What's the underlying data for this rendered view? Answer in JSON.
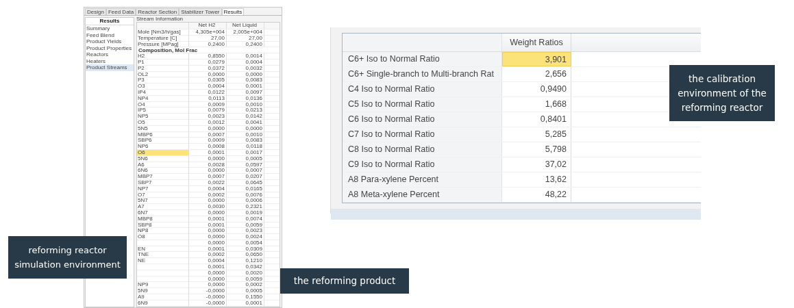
{
  "simulator": {
    "tabs": [
      {
        "label": "Design",
        "selected": false
      },
      {
        "label": "Feed Data",
        "selected": false
      },
      {
        "label": "Reactor Section",
        "selected": false
      },
      {
        "label": "Stabilizer Tower",
        "selected": false
      },
      {
        "label": "Results",
        "selected": true
      }
    ],
    "sidebar": {
      "title": "Results",
      "items": [
        {
          "label": "Summary",
          "selected": false
        },
        {
          "label": "Feed Blend",
          "selected": false
        },
        {
          "label": "Product Yields",
          "selected": false
        },
        {
          "label": "Product Properties",
          "selected": false
        },
        {
          "label": "Reactors",
          "selected": false
        },
        {
          "label": "Heaters",
          "selected": false
        },
        {
          "label": "Product Streams",
          "selected": true
        }
      ]
    },
    "group_title": "Stream Information",
    "columns": [
      "Net H2",
      "Net Liquid"
    ],
    "rows": [
      {
        "kind": "data",
        "label": "Mole [Nm3/h/gas]",
        "values": [
          "4,305e+004",
          "2,005e+004"
        ],
        "selected": false
      },
      {
        "kind": "data",
        "label": "Temperature [C]",
        "values": [
          "27,00",
          "27,00"
        ],
        "selected": false
      },
      {
        "kind": "data",
        "label": "Pressure [MPag]",
        "values": [
          "0,2400",
          "0,2400"
        ],
        "selected": false
      },
      {
        "kind": "section",
        "label": "Composition, Mol Frac"
      },
      {
        "kind": "data",
        "label": "H2",
        "values": [
          "0,8550",
          "0,0014"
        ],
        "selected": false
      },
      {
        "kind": "data",
        "label": "P1",
        "values": [
          "0,0279",
          "0,0004"
        ],
        "selected": false
      },
      {
        "kind": "data",
        "label": "P2",
        "values": [
          "0,0372",
          "0,0032"
        ],
        "selected": false
      },
      {
        "kind": "data",
        "label": "OL2",
        "values": [
          "0,0000",
          "0,0000"
        ],
        "selected": false
      },
      {
        "kind": "data",
        "label": "P3",
        "values": [
          "0,0305",
          "0,0083"
        ],
        "selected": false
      },
      {
        "kind": "data",
        "label": "O3",
        "values": [
          "0,0004",
          "0,0001"
        ],
        "selected": false
      },
      {
        "kind": "data",
        "label": "IP4",
        "values": [
          "0,0122",
          "0,0097"
        ],
        "selected": false
      },
      {
        "kind": "data",
        "label": "NP4",
        "values": [
          "0,0113",
          "0,0136"
        ],
        "selected": false
      },
      {
        "kind": "data",
        "label": "O4",
        "values": [
          "0,0009",
          "0,0010"
        ],
        "selected": false
      },
      {
        "kind": "data",
        "label": "IP5",
        "values": [
          "0,0079",
          "0,0213"
        ],
        "selected": false
      },
      {
        "kind": "data",
        "label": "NP5",
        "values": [
          "0,0023",
          "0,0142"
        ],
        "selected": false
      },
      {
        "kind": "data",
        "label": "O5",
        "values": [
          "0,0012",
          "0,0041"
        ],
        "selected": false
      },
      {
        "kind": "data",
        "label": "5N5",
        "values": [
          "0,0000",
          "0,0000"
        ],
        "selected": false
      },
      {
        "kind": "data",
        "label": "MBP6",
        "values": [
          "0,0007",
          "0,0010"
        ],
        "selected": false
      },
      {
        "kind": "data",
        "label": "SBP6",
        "values": [
          "0,0009",
          "0,0083"
        ],
        "selected": false
      },
      {
        "kind": "data",
        "label": "NP6",
        "values": [
          "0,0008",
          "0,0118"
        ],
        "selected": false
      },
      {
        "kind": "data",
        "label": "O6",
        "values": [
          "0,0001",
          "0,0017"
        ],
        "selected": true
      },
      {
        "kind": "data",
        "label": "5N6",
        "values": [
          "0,0000",
          "0,0005"
        ],
        "selected": false
      },
      {
        "kind": "data",
        "label": "A6",
        "values": [
          "0,0028",
          "0,0597"
        ],
        "selected": false
      },
      {
        "kind": "data",
        "label": "6N6",
        "values": [
          "0,0000",
          "0,0007"
        ],
        "selected": false
      },
      {
        "kind": "data",
        "label": "MBP7",
        "values": [
          "0,0007",
          "0,0207"
        ],
        "selected": false
      },
      {
        "kind": "data",
        "label": "SBP7",
        "values": [
          "0,0022",
          "0,0645"
        ],
        "selected": false
      },
      {
        "kind": "data",
        "label": "NP7",
        "values": [
          "0,0004",
          "0,0165"
        ],
        "selected": false
      },
      {
        "kind": "data",
        "label": "O7",
        "values": [
          "0,0002",
          "0,0076"
        ],
        "selected": false
      },
      {
        "kind": "data",
        "label": "5N7",
        "values": [
          "0,0000",
          "0,0006"
        ],
        "selected": false
      },
      {
        "kind": "data",
        "label": "A7",
        "values": [
          "0,0030",
          "0,2321"
        ],
        "selected": false
      },
      {
        "kind": "data",
        "label": "6N7",
        "values": [
          "0,0000",
          "0,0019"
        ],
        "selected": false
      },
      {
        "kind": "data",
        "label": "MBP8",
        "values": [
          "0,0001",
          "0,0074"
        ],
        "selected": false
      },
      {
        "kind": "data",
        "label": "SBP8",
        "values": [
          "0,0001",
          "0,0059"
        ],
        "selected": false
      },
      {
        "kind": "data",
        "label": "NP8",
        "values": [
          "0,0000",
          "0,0023"
        ],
        "selected": false
      },
      {
        "kind": "data",
        "label": "O8",
        "values": [
          "0,0000",
          "0,0024"
        ],
        "selected": false
      },
      {
        "kind": "data",
        "values": [
          "0,0000",
          "0,0054"
        ],
        "selected": false
      },
      {
        "kind": "data",
        "label": "EN",
        "values": [
          "0,0001",
          "0,0309"
        ],
        "selected": false
      },
      {
        "kind": "data",
        "label": "TNE",
        "values": [
          "0,0002",
          "0,0650"
        ],
        "selected": false
      },
      {
        "kind": "data",
        "label": "NE",
        "values": [
          "0,0004",
          "0,1210"
        ],
        "selected": false
      },
      {
        "kind": "data",
        "values": [
          "0,0001",
          "0,0342"
        ],
        "selected": false
      },
      {
        "kind": "data",
        "values": [
          "0,0000",
          "0,0020"
        ],
        "selected": false
      },
      {
        "kind": "data",
        "values": [
          "0,0000",
          "0,0059"
        ],
        "selected": false
      },
      {
        "kind": "data",
        "label": "NP9",
        "values": [
          "0,0000",
          "0,0002"
        ],
        "selected": false
      },
      {
        "kind": "data",
        "label": "5N9",
        "values": [
          "-0,0000",
          "0,0005"
        ],
        "selected": false
      },
      {
        "kind": "data",
        "label": "A9",
        "values": [
          "-0,0000",
          "0,1550"
        ],
        "selected": false
      },
      {
        "kind": "data",
        "label": "6N9",
        "values": [
          "-0,0000",
          "0,0001"
        ],
        "selected": false
      }
    ]
  },
  "ratios": {
    "columns": [
      "Weight Ratios"
    ],
    "rows": [
      {
        "label": "C6+ Iso to Normal Ratio",
        "value": "3,901",
        "selected": true
      },
      {
        "label": "C6+ Single-branch to Multi-branch Rat",
        "value": "2,656",
        "selected": false
      },
      {
        "label": "C4 Iso to Normal Ratio",
        "value": "0,9490",
        "selected": false
      },
      {
        "label": "C5 Iso to Normal Ratio",
        "value": "1,668",
        "selected": false
      },
      {
        "label": "C6 Iso to Normal Ratio",
        "value": "0,8401",
        "selected": false
      },
      {
        "label": "C7 Iso to Normal Ratio",
        "value": "5,285",
        "selected": false
      },
      {
        "label": "C8 Iso to Normal Ratio",
        "value": "5,798",
        "selected": false
      },
      {
        "label": "C9 Iso to Normal Ratio",
        "value": "37,02",
        "selected": false
      },
      {
        "label": "A8 Para-xylene Percent",
        "value": "13,62",
        "selected": false
      },
      {
        "label": "A8 Meta-xylene Percent",
        "value": "48,22",
        "selected": false
      }
    ]
  },
  "callouts": [
    "the calibration environment of the reforming reactor",
    "reforming reactor simulation environment",
    "the reforming product"
  ]
}
